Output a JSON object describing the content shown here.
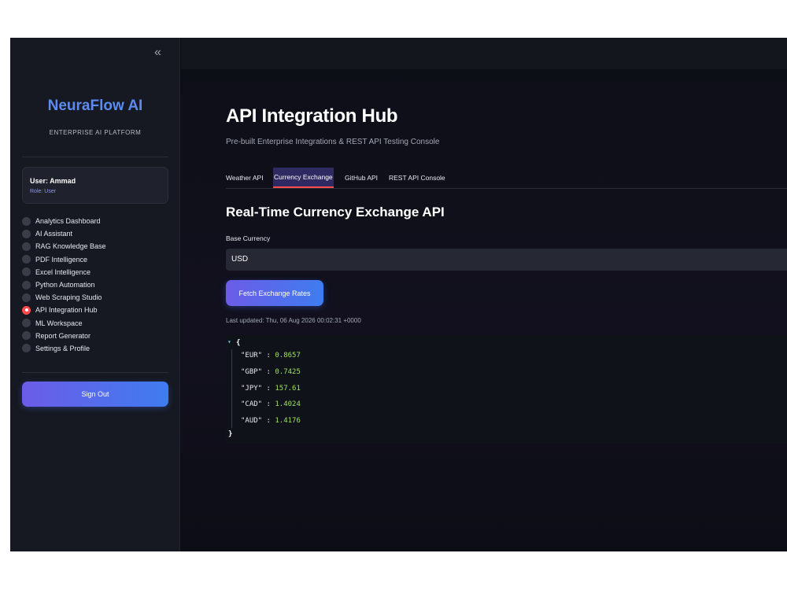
{
  "sidebar": {
    "collapse_glyph": "«",
    "brand": "NeuraFlow AI",
    "brand_subtitle": "ENTERPRISE AI PLATFORM",
    "user": {
      "name": "User: Ammad",
      "role": "Role: User"
    },
    "nav_items": [
      {
        "label": "Analytics Dashboard",
        "selected": false
      },
      {
        "label": "AI Assistant",
        "selected": false
      },
      {
        "label": "RAG Knowledge Base",
        "selected": false
      },
      {
        "label": "PDF Intelligence",
        "selected": false
      },
      {
        "label": "Excel Intelligence",
        "selected": false
      },
      {
        "label": "Python Automation",
        "selected": false
      },
      {
        "label": "Web Scraping Studio",
        "selected": false
      },
      {
        "label": "API Integration Hub",
        "selected": true
      },
      {
        "label": "ML Workspace",
        "selected": false
      },
      {
        "label": "Report Generator",
        "selected": false
      },
      {
        "label": "Settings & Profile",
        "selected": false
      }
    ],
    "sign_out": "Sign Out"
  },
  "main": {
    "title": "API Integration Hub",
    "subtitle": "Pre-built Enterprise Integrations & REST API Testing Console",
    "tabs": [
      {
        "label": "Weather API",
        "active": false
      },
      {
        "label": "Currency Exchange",
        "active": true
      },
      {
        "label": "GitHub API",
        "active": false
      },
      {
        "label": "REST API Console",
        "active": false
      }
    ],
    "section_title": "Real-Time Currency Exchange API",
    "base_currency": {
      "label": "Base Currency",
      "value": "USD"
    },
    "fetch_button": "Fetch Exchange Rates",
    "last_updated": "Last updated: Thu, 06 Aug 2026 00:02:31 +0000",
    "rates_json": {
      "open": "{",
      "close": "}",
      "toggle_glyph": "▾",
      "entries": [
        {
          "key": "\"EUR\"",
          "value": "0.8657"
        },
        {
          "key": "\"GBP\"",
          "value": "0.7425"
        },
        {
          "key": "\"JPY\"",
          "value": "157.61"
        },
        {
          "key": "\"CAD\"",
          "value": "1.4024"
        },
        {
          "key": "\"AUD\"",
          "value": "1.4176"
        }
      ]
    }
  },
  "colors": {
    "accent_gradient_start": "#6c5ce7",
    "accent_gradient_end": "#3f7cf0",
    "selected_radio": "#ff4b4b",
    "json_value": "#9ce25f",
    "brand": "#5c8bf0"
  }
}
